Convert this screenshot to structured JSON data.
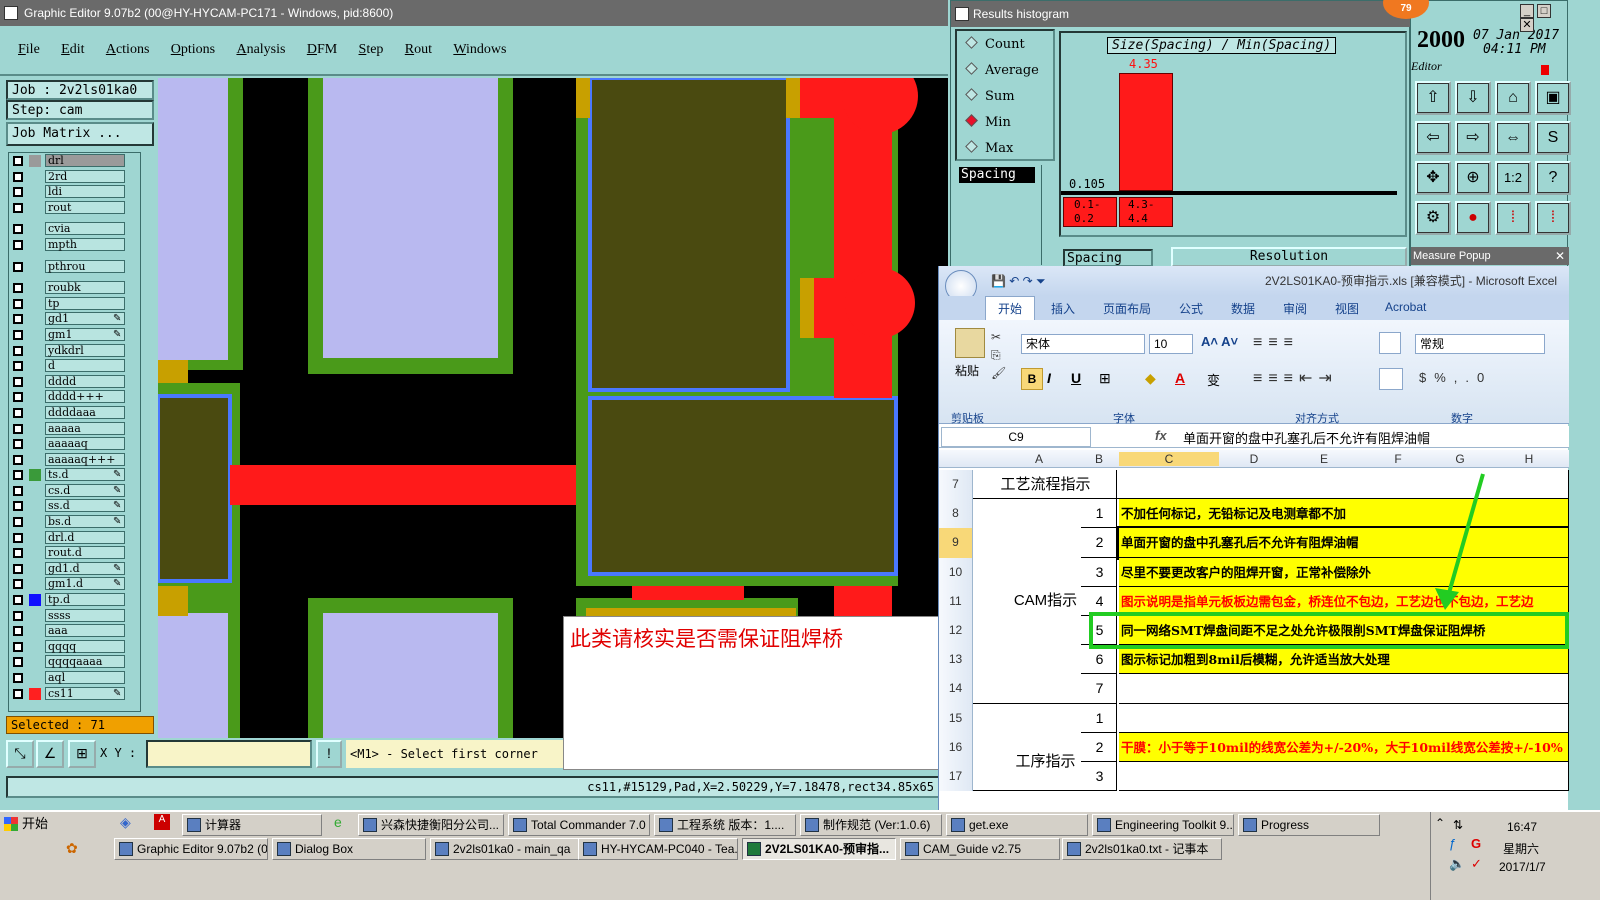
{
  "graphic_editor": {
    "title": "Graphic Editor 9.07b2 (00@HY-HYCAM-PC171 - Windows, pid:8600)",
    "menu": [
      "File",
      "Edit",
      "Actions",
      "Options",
      "Analysis",
      "DFM",
      "Step",
      "Rout",
      "Windows"
    ],
    "job": "Job : 2v2ls01ka0",
    "step": "Step: cam",
    "job_matrix": "Job Matrix ...",
    "layers": [
      {
        "name": "drl",
        "color": "#9a9a9a",
        "mark": ""
      },
      {
        "name": "2rd",
        "color": "",
        "mark": ""
      },
      {
        "name": "ldi",
        "color": "",
        "mark": ""
      },
      {
        "name": "rout",
        "color": "",
        "mark": ""
      },
      {
        "name": "cvia",
        "color": "",
        "mark": ""
      },
      {
        "name": "mpth",
        "color": "",
        "mark": ""
      },
      {
        "name": "pthrou",
        "color": "",
        "mark": ""
      },
      {
        "name": "roubk",
        "color": "",
        "mark": ""
      },
      {
        "name": "tp",
        "color": "",
        "mark": ""
      },
      {
        "name": "gd1",
        "color": "",
        "mark": "✎"
      },
      {
        "name": "gm1",
        "color": "",
        "mark": "✎"
      },
      {
        "name": "ydkdrl",
        "color": "",
        "mark": ""
      },
      {
        "name": "d",
        "color": "",
        "mark": ""
      },
      {
        "name": "dddd",
        "color": "",
        "mark": ""
      },
      {
        "name": "dddd+++",
        "color": "",
        "mark": ""
      },
      {
        "name": "ddddaaa",
        "color": "",
        "mark": ""
      },
      {
        "name": "aaaaa",
        "color": "",
        "mark": ""
      },
      {
        "name": "aaaaaq",
        "color": "",
        "mark": ""
      },
      {
        "name": "aaaaaq+++",
        "color": "",
        "mark": ""
      },
      {
        "name": "ts.d",
        "color": "#3a9a3a",
        "mark": "✎"
      },
      {
        "name": "cs.d",
        "color": "",
        "mark": "✎"
      },
      {
        "name": "ss.d",
        "color": "",
        "mark": "✎"
      },
      {
        "name": "bs.d",
        "color": "",
        "mark": "✎"
      },
      {
        "name": "drl.d",
        "color": "",
        "mark": ""
      },
      {
        "name": "rout.d",
        "color": "",
        "mark": ""
      },
      {
        "name": "gd1.d",
        "color": "",
        "mark": "✎"
      },
      {
        "name": "gm1.d",
        "color": "",
        "mark": "✎"
      },
      {
        "name": "tp.d",
        "color": "#1010ff",
        "mark": ""
      },
      {
        "name": "ssss",
        "color": "",
        "mark": ""
      },
      {
        "name": "aaa",
        "color": "",
        "mark": ""
      },
      {
        "name": "qqqq",
        "color": "",
        "mark": ""
      },
      {
        "name": "qqqqaaaa",
        "color": "",
        "mark": ""
      },
      {
        "name": "aql",
        "color": "",
        "mark": ""
      },
      {
        "name": "cs11",
        "color": "#ff2020",
        "mark": "✎"
      }
    ],
    "selected": "Selected : 71",
    "xy_label": "X Y :",
    "xy_value": "",
    "prompt": "<M1> - Select first corner",
    "status": "cs11,#15129,Pad,X=2.50229,Y=7.18478,rect34.85x65",
    "note": "此类请核实是否需保证阻焊桥",
    "colors": {
      "copper": "#4a4a10",
      "mask": "#4a9a1a",
      "pad": "#b9b9f0",
      "trace": "#ff1a1a",
      "outline": "#4a78ff",
      "gold": "#c8a000"
    }
  },
  "histogram": {
    "title": "Results histogram",
    "modes": [
      {
        "label": "Count",
        "selected": false
      },
      {
        "label": "Average",
        "selected": false
      },
      {
        "label": "Sum",
        "selected": false
      },
      {
        "label": "Min",
        "selected": true
      },
      {
        "label": "Max",
        "selected": false
      }
    ],
    "measure": "Spacing",
    "heading": "Size(Spacing) / Min(Spacing)",
    "y_value": "4.35",
    "y_min": "0.105",
    "bins": [
      {
        "label_top": "0.1-",
        "label_bot": "0.2",
        "value": 0.105
      },
      {
        "label_top": "4.3-",
        "label_bot": "4.4",
        "value": 4.35
      }
    ],
    "footer_left": "Spacing",
    "footer_right": "Resolution",
    "measure_popup": "Measure Popup"
  },
  "editor_toolbar": {
    "year": "2000",
    "date": "07 Jan 2017",
    "time": "04:11 PM",
    "label": "Editor",
    "badge": "79"
  },
  "excel": {
    "title": "2V2LS01KA0-预审指示.xls [兼容模式] - Microsoft Excel",
    "tabs": [
      "开始",
      "插入",
      "页面布局",
      "公式",
      "数据",
      "审阅",
      "视图",
      "Acrobat"
    ],
    "font_name": "宋体",
    "font_size": "10",
    "number_format": "常规",
    "groups": [
      "剪贴板",
      "字体",
      "对齐方式",
      "数字"
    ],
    "paste": "粘贴",
    "name_box": "C9",
    "formula": "单面开窗的盘中孔塞孔后不允许有阻焊油帽",
    "columns": [
      "A",
      "B",
      "C",
      "D",
      "E",
      "F",
      "G",
      "H"
    ],
    "row_numbers": [
      "7",
      "8",
      "9",
      "10",
      "11",
      "12",
      "13",
      "14",
      "15",
      "16",
      "17"
    ],
    "section_flow": "工艺流程指示",
    "section_cam": "CAM指示",
    "section_process": "工序指示",
    "rows": [
      {
        "num": "1",
        "text": "不加任何标记，无铅标记及电测章都不加",
        "color": "#000000",
        "fill": "#ffff00"
      },
      {
        "num": "2",
        "text": "单面开窗的盘中孔塞孔后不允许有阻焊油帽",
        "color": "#000000",
        "fill": "#ffff00"
      },
      {
        "num": "3",
        "text": "尽里不要更改客户的阻焊开窗，正常补偿除外",
        "color": "#000000",
        "fill": "#ffff00"
      },
      {
        "num": "4",
        "text": "图示说明是指单元板板边需包金，桥连位不包边，工艺边也不包边，工艺边",
        "color": "#ff0000",
        "fill": "#ffff00"
      },
      {
        "num": "5",
        "text": "同一网络SMT焊盘间距不足之处允许极限削SMT焊盘保证阻焊桥",
        "color": "#000000",
        "fill": "#ffff00"
      },
      {
        "num": "6",
        "text": "图示标记加粗到8mil后模糊，允许适当放大处理",
        "color": "#000000",
        "fill": "#ffff00"
      },
      {
        "num": "7",
        "text": "",
        "color": "#000000",
        "fill": "#ffffff"
      },
      {
        "num": "1",
        "text": "",
        "color": "#000000",
        "fill": "#ffffff"
      },
      {
        "num": "2",
        "text": "干膜：小于等于10mil的线宽公差为+/-20%，大于10mil线宽公差按+/-10%",
        "color": "#ff0000",
        "fill": "#ffff00"
      },
      {
        "num": "3",
        "text": "",
        "color": "#000000",
        "fill": "#ffffff"
      }
    ]
  },
  "taskbar": {
    "start": "开始",
    "row1": [
      {
        "label": "计算器",
        "icon": "calculator-icon"
      },
      {
        "label": "兴森快捷衡阳分公司...",
        "icon": "star-icon"
      },
      {
        "label": "Total Commander 7.0 ...",
        "icon": "disk-icon"
      },
      {
        "label": "工程系统  版本：1....",
        "icon": "p-icon"
      },
      {
        "label": "制作规范 (Ver:1.0.6)",
        "icon": "doc-icon"
      },
      {
        "label": "get.exe",
        "icon": "globe-icon"
      },
      {
        "label": "Engineering Toolkit 9....",
        "icon": "window-icon"
      },
      {
        "label": "Progress",
        "icon": "window-icon"
      }
    ],
    "row2": [
      {
        "label": "Graphic Editor 9.07b2 (0...",
        "icon": "window-icon",
        "active": false
      },
      {
        "label": "Dialog Box",
        "icon": "window-icon",
        "active": false
      },
      {
        "label": "2v2ls01ka0 - main_qa",
        "icon": "window-icon",
        "active": false
      },
      {
        "label": "HY-HYCAM-PC040 - Tea...",
        "icon": "teamviewer-icon",
        "active": false
      },
      {
        "label": "2V2LS01KA0-预审指...",
        "icon": "excel-icon",
        "active": true
      },
      {
        "label": "CAM_Guide v2.75",
        "icon": "app-icon",
        "active": false
      },
      {
        "label": "2v2ls01ka0.txt - 记事本",
        "icon": "notepad-icon",
        "active": false
      }
    ],
    "clock": "16:47",
    "weekday": "星期六",
    "date": "2017/1/7"
  }
}
